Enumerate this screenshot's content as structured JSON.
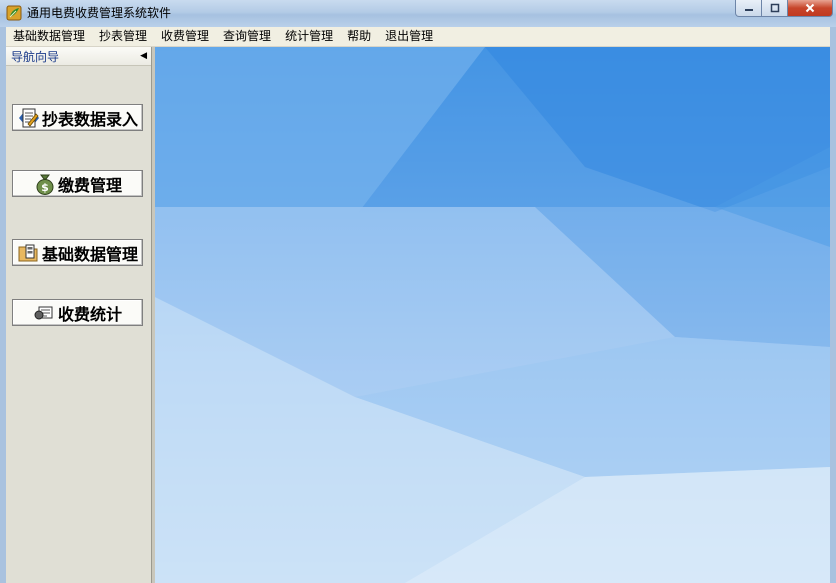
{
  "window": {
    "title": "通用电费收费管理系统软件",
    "app_icon": "leaf-app-icon",
    "controls": {
      "minimize_icon": "minimize-icon",
      "maximize_icon": "maximize-icon",
      "close_icon": "close-icon"
    }
  },
  "menubar": {
    "items": [
      {
        "label": "基础数据管理"
      },
      {
        "label": "抄表管理"
      },
      {
        "label": "收费管理"
      },
      {
        "label": "查询管理"
      },
      {
        "label": "统计管理"
      },
      {
        "label": "帮助"
      },
      {
        "label": "退出管理"
      }
    ]
  },
  "nav": {
    "header": "导航向导",
    "collapse_icon": "collapse-left-icon",
    "buttons": [
      {
        "label": "抄表数据录入",
        "icon": "meter-form-icon"
      },
      {
        "label": "缴费管理",
        "icon": "money-bag-icon"
      },
      {
        "label": "基础数据管理",
        "icon": "folder-data-icon"
      },
      {
        "label": "收费统计",
        "icon": "statistics-icon"
      }
    ]
  },
  "colors": {
    "desktop_blue": "#4a9ae6",
    "menubar_bg": "#f1efe2",
    "nav_bg": "#e0dfd5",
    "nav_header_text": "#1a3a8a"
  }
}
